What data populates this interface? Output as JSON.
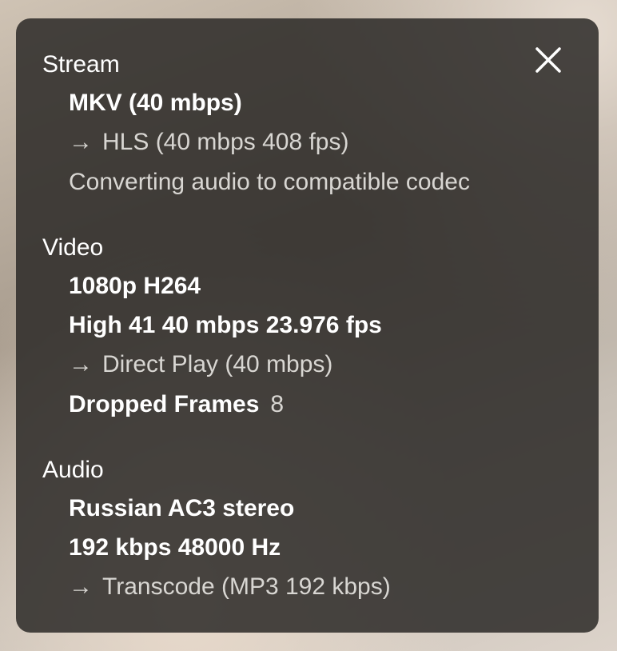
{
  "panel": {
    "close_icon": "close-icon"
  },
  "stream": {
    "title": "Stream",
    "container": "MKV (40 mbps)",
    "arrow": "→",
    "output": "HLS (40 mbps 408 fps)",
    "note": "Converting audio to compatible codec"
  },
  "video": {
    "title": "Video",
    "resolution": "1080p H264",
    "profile": "High 41 40 mbps 23.976 fps",
    "arrow": "→",
    "mode": "Direct Play (40 mbps)",
    "dropped_label": "Dropped Frames",
    "dropped_value": "8"
  },
  "audio": {
    "title": "Audio",
    "track": "Russian AC3 stereo",
    "format": "192 kbps 48000 Hz",
    "arrow": "→",
    "mode": "Transcode (MP3 192 kbps)"
  }
}
